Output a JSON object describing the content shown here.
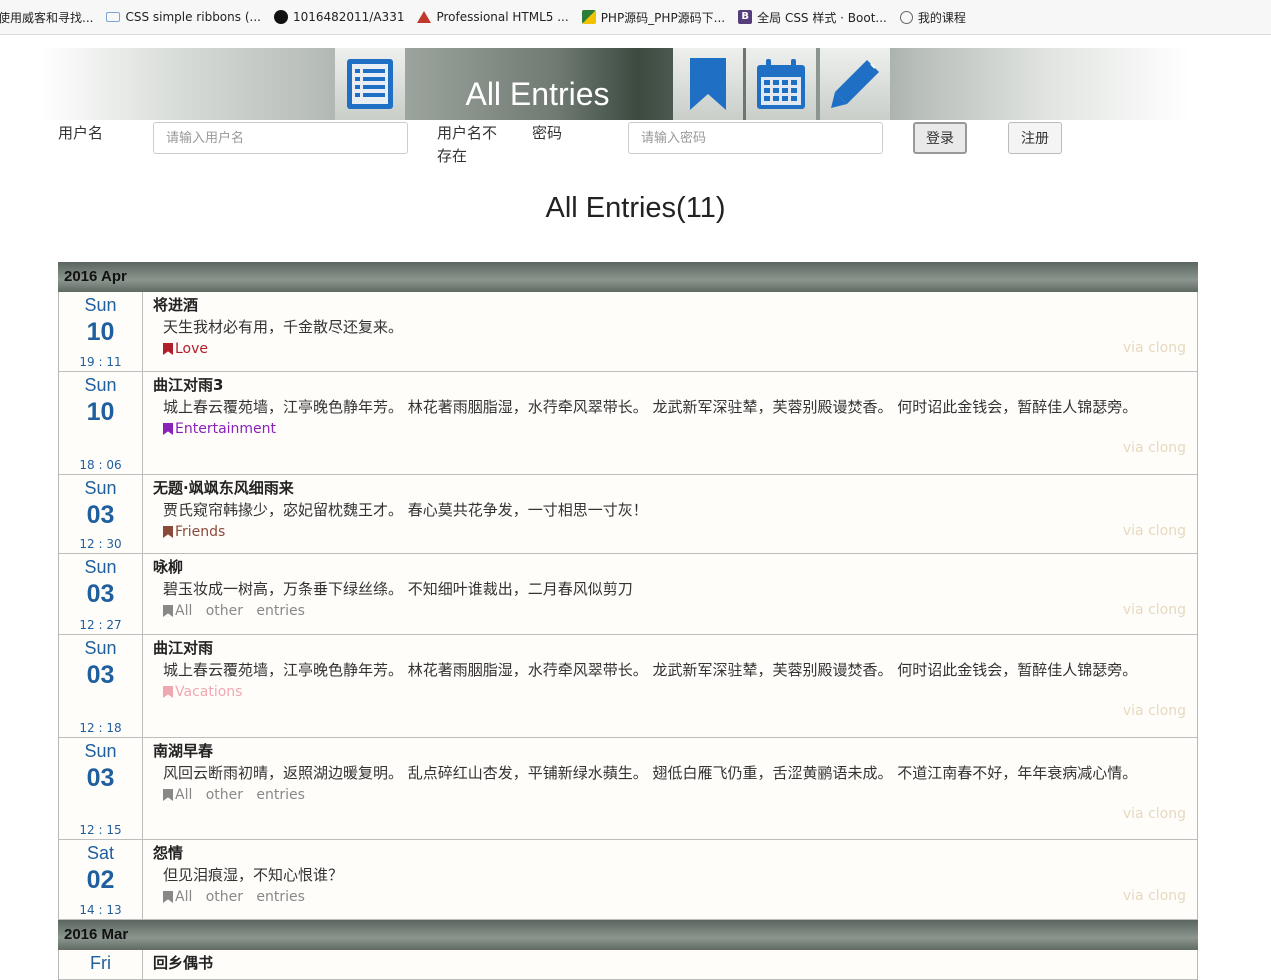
{
  "bookmarks": [
    {
      "label": "使用威客和寻找...",
      "icon": "blank-icon"
    },
    {
      "label": "CSS simple ribbons (...",
      "icon": "cloud-icon"
    },
    {
      "label": "1016482011/A331",
      "icon": "github-icon"
    },
    {
      "label": "Professional HTML5 ...",
      "icon": "triangle-logo-icon"
    },
    {
      "label": "PHP源码_PHP源码下...",
      "icon": "php-icon"
    },
    {
      "label": "全局 CSS 样式 · Boot...",
      "icon": "bootstrap-icon"
    },
    {
      "label": "我的课程",
      "icon": "globe-icon"
    }
  ],
  "header": {
    "title": "All Entries",
    "icons": [
      "list-icon",
      "bookmark-icon",
      "calendar-icon",
      "pencil-icon"
    ],
    "accent": "#1f6fc4"
  },
  "login": {
    "username_label": "用户名",
    "username_placeholder": "请输入用户名",
    "username_status": "用户名不存在",
    "password_label": "密码",
    "password_placeholder": "请输入密码",
    "login_button": "登录",
    "register_button": "注册"
  },
  "page_title": "All Entries(11)",
  "groups": [
    {
      "month": "2016 Apr",
      "entries": [
        {
          "weekday": "Sun",
          "day": "10",
          "time": "19 : 11",
          "title": "将进酒",
          "text": "天生我材必有用，千金散尽还复来。",
          "tag": "Love",
          "tag_color": "#b01e2a",
          "via": "via clong"
        },
        {
          "weekday": "Sun",
          "day": "10",
          "time": "18 : 06",
          "title": "曲江对雨3",
          "text": "城上春云覆苑墙，江亭晚色静年芳。 林花著雨胭脂湿，水荇牵风翠带长。 龙武新军深驻辇，芙蓉别殿谩焚香。 何时诏此金钱会，暂醉佳人锦瑟旁。",
          "tag": "Entertainment",
          "tag_color": "#8a22b8",
          "via": "via clong"
        },
        {
          "weekday": "Sun",
          "day": "03",
          "time": "12 : 30",
          "title": "无题·飒飒东风细雨来",
          "text": "贾氏窥帘韩掾少，宓妃留枕魏王才。 春心莫共花争发，一寸相思一寸灰！",
          "tag": "Friends",
          "tag_color": "#8b4a3a",
          "via": "via clong"
        },
        {
          "weekday": "Sun",
          "day": "03",
          "time": "12 : 27",
          "title": "咏柳",
          "text": "碧玉妆成一树高，万条垂下绿丝绦。 不知细叶谁裁出，二月春风似剪刀",
          "tag": "All   other   entries",
          "tag_color": "#888888",
          "via": "via clong"
        },
        {
          "weekday": "Sun",
          "day": "03",
          "time": "12 : 18",
          "title": "曲江对雨",
          "text": "城上春云覆苑墙，江亭晚色静年芳。 林花著雨胭脂湿，水荇牵风翠带长。 龙武新军深驻辇，芙蓉别殿谩焚香。 何时诏此金钱会，暂醉佳人锦瑟旁。",
          "tag": "Vacations",
          "tag_color": "#f0a8b0",
          "via": "via clong"
        },
        {
          "weekday": "Sun",
          "day": "03",
          "time": "12 : 15",
          "title": "南湖早春",
          "text": "风回云断雨初晴，返照湖边暖复明。 乱点碎红山杏发，平铺新绿水蘋生。 翅低白雁飞仍重，舌涩黄鹂语未成。 不道江南春不好，年年衰病减心情。",
          "tag": "All   other   entries",
          "tag_color": "#888888",
          "via": "via clong"
        },
        {
          "weekday": "Sat",
          "day": "02",
          "time": "14 : 13",
          "title": "怨情",
          "text": "但见泪痕湿，不知心恨谁？",
          "tag": "All   other   entries",
          "tag_color": "#888888",
          "via": "via clong"
        }
      ]
    },
    {
      "month": "2016 Mar",
      "entries": [
        {
          "weekday": "Fri",
          "day": "",
          "time": "",
          "title": "回乡偶书",
          "text": "",
          "tag": "",
          "tag_color": "#888888",
          "via": ""
        }
      ]
    }
  ]
}
